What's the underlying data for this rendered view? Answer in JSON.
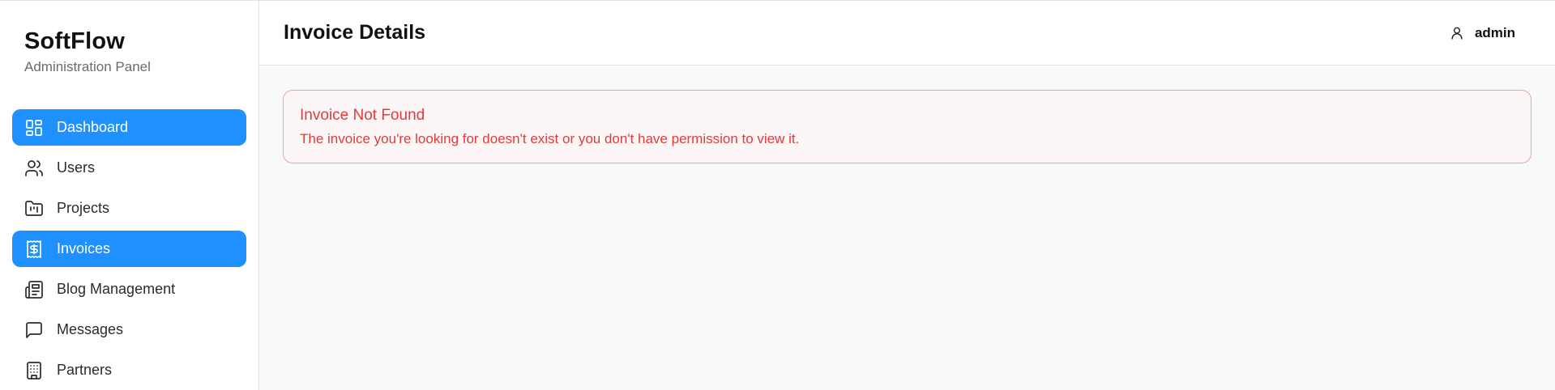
{
  "brand": {
    "title": "SoftFlow",
    "subtitle": "Administration Panel"
  },
  "sidebar": {
    "items": [
      {
        "label": "Dashboard",
        "icon": "dashboard-icon",
        "active": true
      },
      {
        "label": "Users",
        "icon": "users-icon",
        "active": false
      },
      {
        "label": "Projects",
        "icon": "folder-kanban-icon",
        "active": false
      },
      {
        "label": "Invoices",
        "icon": "receipt-dollar-icon",
        "active": true
      },
      {
        "label": "Blog Management",
        "icon": "newspaper-icon",
        "active": false
      },
      {
        "label": "Messages",
        "icon": "message-square-icon",
        "active": false
      },
      {
        "label": "Partners",
        "icon": "building-icon",
        "active": false
      }
    ]
  },
  "header": {
    "title": "Invoice Details",
    "user": "admin",
    "user_icon": "user-icon"
  },
  "alert": {
    "title": "Invoice Not Found",
    "message": "The invoice you're looking for doesn't exist or you don't have permission to view it."
  },
  "colors": {
    "accent": "#1e90ff",
    "error": "#e03b3b",
    "error_border": "#f4a0a0"
  }
}
